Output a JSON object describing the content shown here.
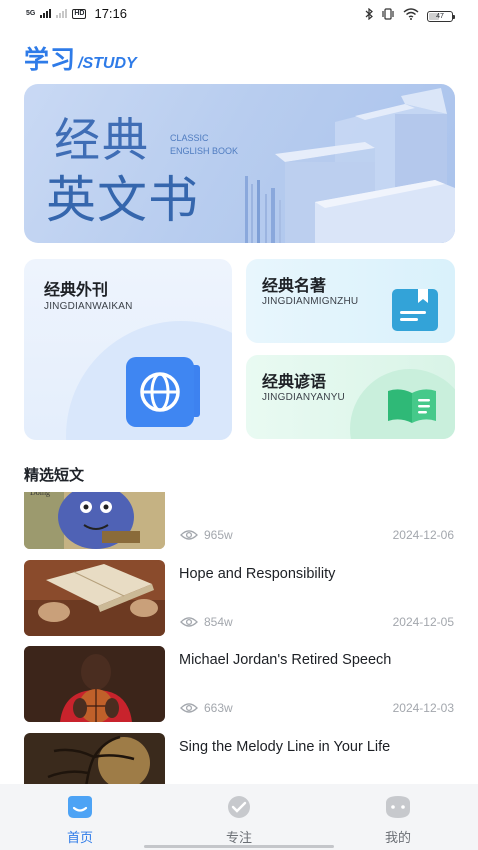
{
  "status_bar": {
    "network": "5G",
    "hd": "HD",
    "time": "17:16",
    "battery": "47",
    "battery_level": 0.47
  },
  "header": {
    "title_cn": "学习",
    "title_en": "/STUDY"
  },
  "banner": {
    "line1": "经典",
    "line2": "英文书",
    "sub1": "CLASSIC",
    "sub2": "ENGLISH BOOK"
  },
  "categories": [
    {
      "title": "经典外刊",
      "subtitle": "JINGDIANWAIKAN",
      "icon": "globe-book-icon"
    },
    {
      "title": "经典名著",
      "subtitle": "JINGDIANMIGNZHU",
      "icon": "bookmark-book-icon"
    },
    {
      "title": "经典谚语",
      "subtitle": "JINGDIANYANYU",
      "icon": "open-book-icon"
    }
  ],
  "section": {
    "title": "精选短文"
  },
  "articles": [
    {
      "title": "",
      "views": "965w",
      "date": "2024-12-06",
      "thumb": "monster-drawing"
    },
    {
      "title": "Hope and Responsibility",
      "views": "854w",
      "date": "2024-12-05",
      "thumb": "open-book-photo"
    },
    {
      "title": "Michael Jordan's Retired Speech",
      "views": "663w",
      "date": "2024-12-03",
      "thumb": "basketball-player-photo"
    },
    {
      "title": "Sing the Melody Line in Your Life",
      "views": "",
      "date": "",
      "thumb": "tree-sunset-photo"
    }
  ],
  "bottom_nav": [
    {
      "label": "首页",
      "icon": "home-face-icon",
      "active": true
    },
    {
      "label": "专注",
      "icon": "focus-check-icon",
      "active": false
    },
    {
      "label": "我的",
      "icon": "profile-face-icon",
      "active": false
    }
  ],
  "colors": {
    "accent": "#2e7be8",
    "muted_text": "#a3a7ad"
  }
}
